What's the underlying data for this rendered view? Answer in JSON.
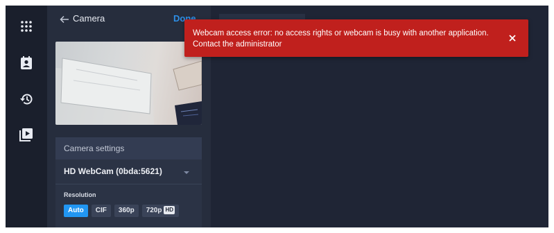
{
  "header": {
    "title": "Camera",
    "done_label": "Done"
  },
  "rail": {
    "items": [
      {
        "icon": "apps-grid-icon"
      },
      {
        "icon": "contacts-icon"
      },
      {
        "icon": "history-icon"
      },
      {
        "icon": "media-playlist-icon"
      }
    ]
  },
  "settings": {
    "title": "Camera settings",
    "device": "HD WebCam (0bda:5621)",
    "resolution_label": "Resolution",
    "options": [
      "Auto",
      "CIF",
      "360p",
      "720p"
    ],
    "hd_badge": "HD",
    "selected": "Auto"
  },
  "toast": {
    "line1": "Webcam access error: no access rights or webcam is busy with another application.",
    "line2": "Contact the administrator"
  },
  "colors": {
    "accent": "#2196f3",
    "error": "#c0201d",
    "background": "#1e2433"
  }
}
